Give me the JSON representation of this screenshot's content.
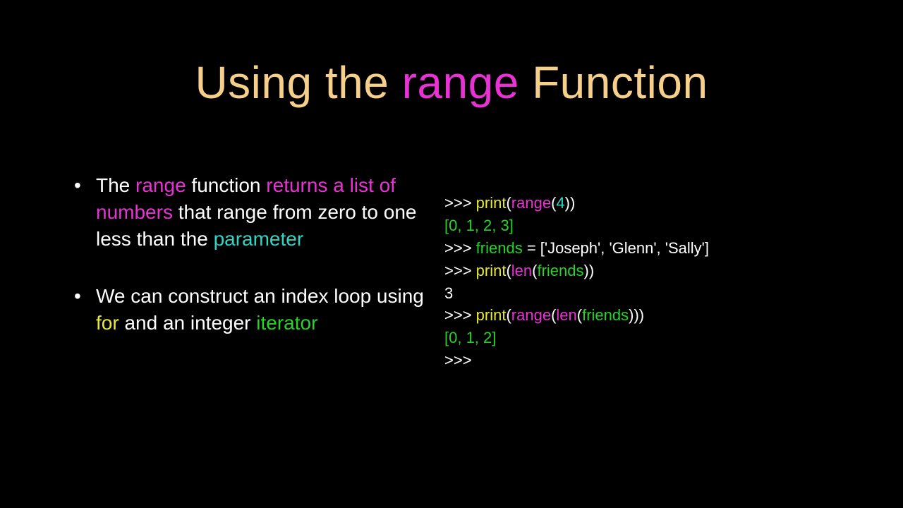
{
  "title": {
    "using_the": "Using the ",
    "range": "range",
    "function": " Function"
  },
  "bullets": {
    "b1": {
      "pre": "The ",
      "range": "range",
      "mid1": " function ",
      "returns_a": "returns a list of numbers",
      "mid2": " that range from zero to one less than the ",
      "param": "parameter"
    },
    "b2": {
      "pre": "We can construct an index loop using ",
      "for": "for",
      "mid": " and an integer ",
      "iterator": "iterator"
    }
  },
  "code": {
    "l1": {
      "prompt": ">>> ",
      "print": "print",
      "lp": "(",
      "range": "range",
      "arg_open": "(",
      "four": "4",
      "close": "))"
    },
    "l2": "[0, 1, 2, 3]",
    "l3": {
      "prompt": ">>> ",
      "friends": "friends",
      "rest": " = ['Joseph', 'Glenn', 'Sally']"
    },
    "l4": {
      "prompt": ">>> ",
      "print": "print",
      "lp": "(",
      "len": "len",
      "lp2": "(",
      "friends": "friends",
      "close": "))"
    },
    "l5": "3",
    "l6": {
      "prompt": ">>> ",
      "print": "print",
      "lp": "(",
      "range": "range",
      "lp2": "(",
      "len": "len",
      "lp3": "(",
      "friends": "friends",
      "close": ")))"
    },
    "l7": "[0, 1, 2]",
    "l8": ">>> "
  }
}
